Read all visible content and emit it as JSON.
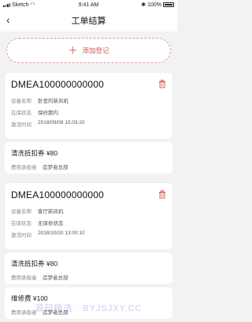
{
  "status": {
    "carrier": "Sketch",
    "time": "9:41 AM",
    "battery": "100%"
  },
  "nav": {
    "title": "工单结算"
  },
  "add": {
    "label": "添加登记"
  },
  "cards": [
    {
      "order_no": "DMEA100000000000",
      "rows": [
        {
          "key": "设备名称",
          "val": "卧室的新风机"
        },
        {
          "key": "在保状态",
          "val": "保修期内"
        },
        {
          "key": "激活时间",
          "val": "2018/09/08 15:03:20"
        }
      ],
      "coupon": {
        "title": "清洗抵扣券  ¥80",
        "payer_key": "费用承担者",
        "payer_val": "造梦者总部"
      }
    },
    {
      "order_no": "DMEA100000000000",
      "rows": [
        {
          "key": "设备名称",
          "val": "客厅新风机"
        },
        {
          "key": "在保状态",
          "val": "无保修状态"
        },
        {
          "key": "激活时间",
          "val": "2018/10/20 13:00:10"
        }
      ],
      "coupon": {
        "title": "清洗抵扣券  ¥80",
        "payer_key": "费用承担者",
        "payer_val": "造梦者总部"
      },
      "extra": {
        "title": "维修费  ¥100",
        "payer_key": "费用承担者",
        "payer_val": "造梦者总部"
      }
    }
  ],
  "watermark": "源码精选 · BYJSJXY.CC",
  "colors": {
    "accent": "#d65454",
    "bg": "#f2f2f4"
  }
}
